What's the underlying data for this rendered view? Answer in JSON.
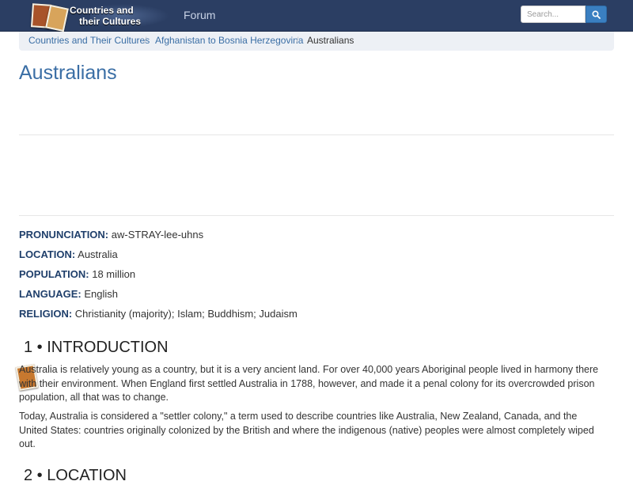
{
  "header": {
    "logo_line1": "Countries and",
    "logo_line2": "their Cultures",
    "forum_label": "Forum",
    "search_placeholder": "Search...",
    "search_icon": "magnifier-icon",
    "bg_color": "#2b3e63",
    "button_color": "#3a7fc1"
  },
  "breadcrumb": {
    "items": [
      "Countries and Their Cultures",
      "Afghanistan to Bosnia Herzegovina",
      "Australians"
    ],
    "separator": "/"
  },
  "page": {
    "title": "Australians",
    "title_color": "#3a6ea5"
  },
  "facts": [
    {
      "label": "PRONUNCIATION:",
      "value": "aw-STRAY-lee-uhns"
    },
    {
      "label": "LOCATION:",
      "value": "Australia"
    },
    {
      "label": "POPULATION:",
      "value": "18 million"
    },
    {
      "label": "LANGUAGE:",
      "value": "English"
    },
    {
      "label": "RELIGION:",
      "value": "Christianity (majority); Islam; Buddhism; Judaism"
    }
  ],
  "sections": [
    {
      "heading": "1 • INTRODUCTION",
      "paragraphs": [
        "Australia is relatively young as a country, but it is a very ancient land. For over 40,000 years Aboriginal people lived in harmony there with their environment. When England first settled Australia in 1788, however, and made it a penal colony for its overcrowded prison population, all that was to change.",
        "Today, Australia is considered a \"settler colony,\" a term used to describe countries like Australia, New Zealand, Canada, and the United States: countries originally colonized by the British and where the indigenous (native) peoples were almost completely wiped out."
      ]
    },
    {
      "heading": "2 • LOCATION"
    }
  ]
}
